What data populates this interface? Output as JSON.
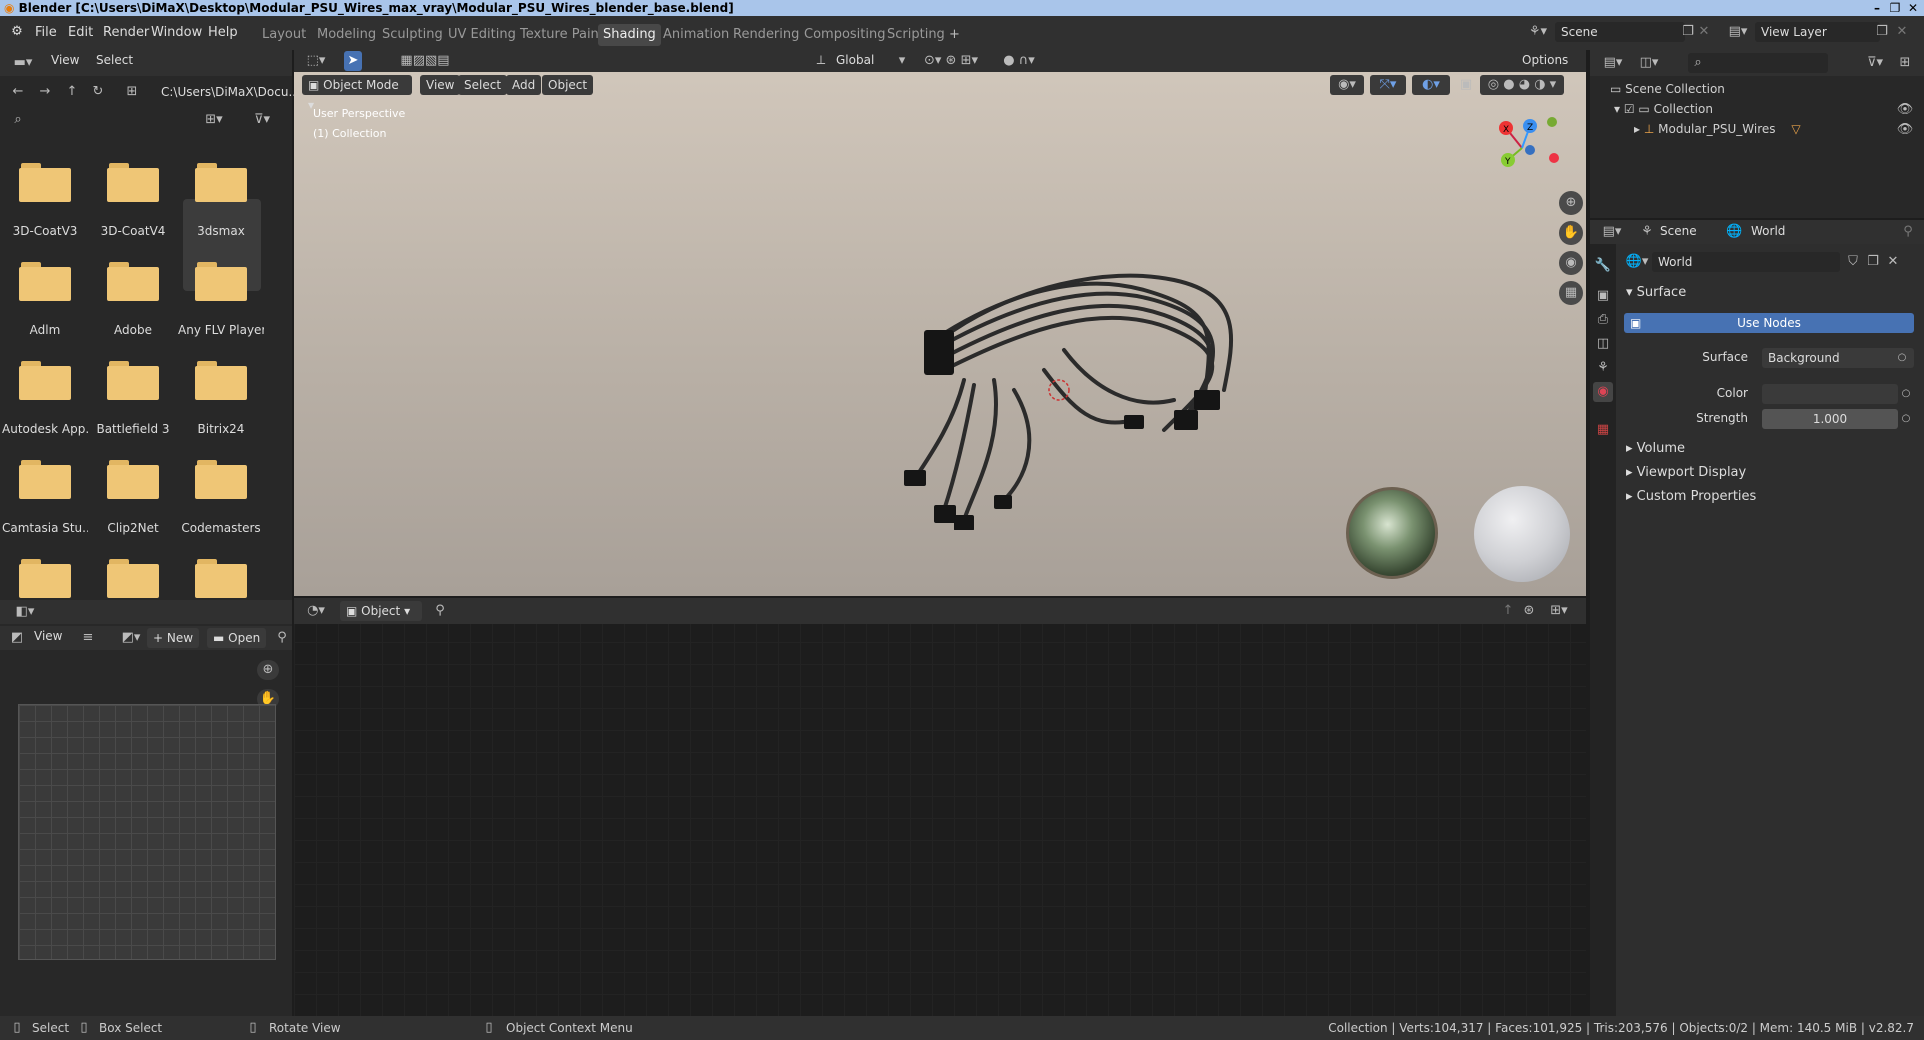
{
  "window": {
    "title": "Blender [C:\\Users\\DiMaX\\Desktop\\Modular_PSU_Wires_max_vray\\Modular_PSU_Wires_blender_base.blend]",
    "minimize": "–",
    "maximize": "❐",
    "close": "✕"
  },
  "menubar": {
    "items": [
      "File",
      "Edit",
      "Render",
      "Window",
      "Help"
    ]
  },
  "workspaces": {
    "tabs": [
      "Layout",
      "Modeling",
      "Sculpting",
      "UV Editing",
      "Texture Paint",
      "Shading",
      "Animation",
      "Rendering",
      "Compositing",
      "Scripting"
    ],
    "active": "Shading",
    "add": "+"
  },
  "scene_selector": {
    "value": "Scene"
  },
  "view_layer_selector": {
    "value": "View Layer"
  },
  "file_browser": {
    "menu": [
      "View",
      "Select"
    ],
    "path": "C:\\Users\\DiMaX\\Docu...",
    "search_placeholder": "",
    "folders": [
      "3D-CoatV3",
      "3D-CoatV4",
      "3dsmax",
      "Adlm",
      "Adobe",
      "Any FLV Player",
      "Autodesk App..",
      "Battlefield 3",
      "Bitrix24",
      "Camtasia Stu..",
      "Clip2Net",
      "Codemasters",
      "",
      "",
      ""
    ],
    "selected": "3dsmax"
  },
  "viewport": {
    "header": {
      "mode": "Object Mode",
      "menu": [
        "View",
        "Select",
        "Add",
        "Object"
      ],
      "orientation": "Global",
      "options": "Options"
    },
    "overlay_text": {
      "perspective": "User Perspective",
      "collection": "(1) Collection"
    },
    "gizmo": {
      "x": "X",
      "y": "Y",
      "z": "Z"
    }
  },
  "image_editor": {
    "view": "View",
    "new": "New",
    "open": "Open"
  },
  "node_editor": {
    "object_selector": "Object"
  },
  "outliner": {
    "scene_collection": "Scene Collection",
    "collection": "Collection",
    "object": "Modular_PSU_Wires"
  },
  "properties": {
    "breadcrumb_scene": "Scene",
    "breadcrumb_world": "World",
    "world_name": "World",
    "surface_section": "Surface",
    "use_nodes": "Use Nodes",
    "surface_label": "Surface",
    "surface_value": "Background",
    "color_label": "Color",
    "strength_label": "Strength",
    "strength_value": "1.000",
    "sections": [
      "Volume",
      "Viewport Display",
      "Custom Properties"
    ],
    "accent": "#4772b3"
  },
  "statusbar": {
    "select": "Select",
    "box_select": "Box Select",
    "rotate_view": "Rotate View",
    "context_menu": "Object Context Menu",
    "stats": "Collection | Verts:104,317 | Faces:101,925 | Tris:203,576 | Objects:0/2 | Mem: 140.5 MiB | v2.82.7"
  }
}
